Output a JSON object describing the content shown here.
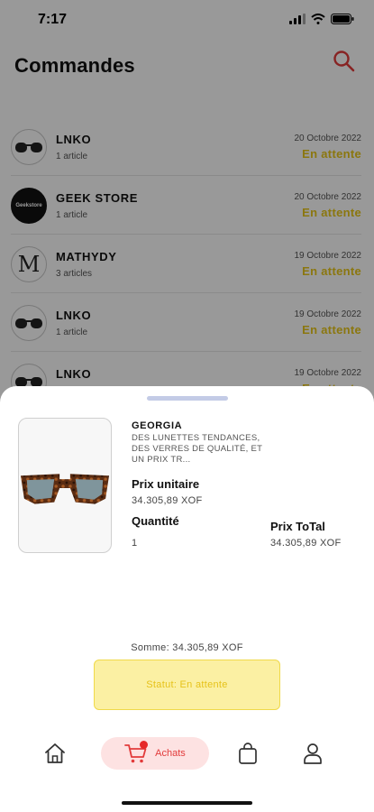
{
  "status_bar": {
    "time": "7:17"
  },
  "header": {
    "title": "Commandes"
  },
  "orders": [
    {
      "shop": "LNKO",
      "articles": "1 article",
      "date": "20 Octobre 2022",
      "status": "En attente",
      "avatar": "sunglasses-logo"
    },
    {
      "shop": "GEEK STORE",
      "articles": "1 article",
      "date": "20 Octobre 2022",
      "status": "En attente",
      "avatar": "geek-store-logo",
      "avatar_text": "Geekstore"
    },
    {
      "shop": "MATHYDY",
      "articles": "3 articles",
      "date": "19 Octobre 2022",
      "status": "En attente",
      "avatar": "m-logo",
      "avatar_text": "M"
    },
    {
      "shop": "LNKO",
      "articles": "1 article",
      "date": "19 Octobre 2022",
      "status": "En attente",
      "avatar": "sunglasses-logo"
    },
    {
      "shop": "LNKO",
      "articles": "",
      "date": "19 Octobre 2022",
      "status": "En attente",
      "avatar": "sunglasses-logo"
    }
  ],
  "sheet": {
    "product_name": "GEORGIA",
    "product_desc": "DES LUNETTES TENDANCES, DES VERRES DE QUALITÉ, ET UN PRIX TR...",
    "unit_price_label": "Prix unitaire",
    "unit_price_value": "34.305,89  XOF",
    "quantity_label": "Quantité",
    "quantity_value": "1",
    "total_label": "Prix ToTal",
    "total_value": "34.305,89  XOF",
    "sum_text": "Somme: 34.305,89  XOF",
    "status_text": "Statut: En attente"
  },
  "tab_bar": {
    "achats_label": "Achats",
    "active_tab": "achats"
  },
  "colors": {
    "accent_red": "#e23b3b",
    "status_yellow": "#e8c619",
    "status_box_bg": "#fbf0a3"
  },
  "icons": {
    "search": "search-icon",
    "home": "home-icon",
    "cart": "cart-icon",
    "bag": "bag-icon",
    "profile": "profile-icon"
  }
}
